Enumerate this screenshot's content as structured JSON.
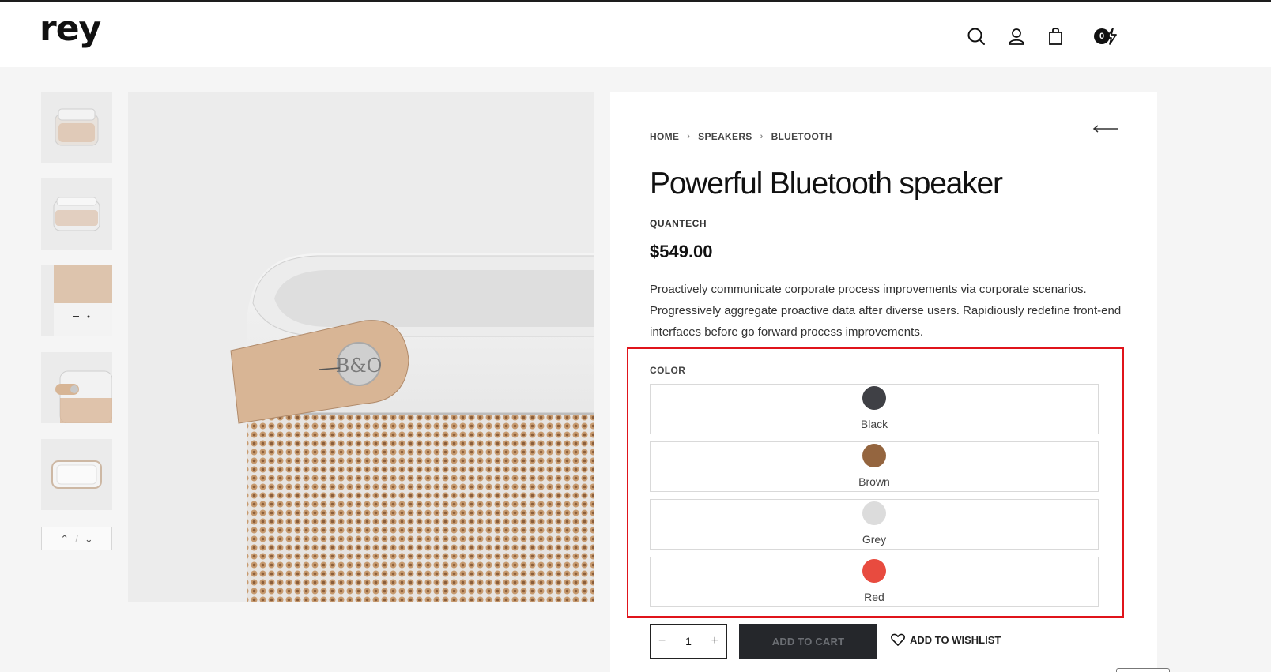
{
  "header": {
    "logo": "rey",
    "cart_count": "0"
  },
  "gallery": {
    "thumbnails": [
      "Speaker front view",
      "Speaker angled view",
      "Speaker detail grille",
      "Speaker side strap",
      "Speaker top view"
    ],
    "nav": {
      "up": "⌃",
      "sep": "/",
      "down": "⌄"
    }
  },
  "product": {
    "breadcrumb": [
      "HOME",
      "SPEAKERS",
      "BLUETOOTH"
    ],
    "title": "Powerful Bluetooth speaker",
    "brand": "QUANTECH",
    "price": "$549.00",
    "description": "Proactively communicate corporate process improvements via corporate scenarios. Progressively aggregate proactive data after diverse users. Rapidiously redefine front-end interfaces before go forward process improvements.",
    "color_label": "COLOR",
    "colors": [
      {
        "name": "Black",
        "hex": "#3f4045"
      },
      {
        "name": "Brown",
        "hex": "#94653f"
      },
      {
        "name": "Grey",
        "hex": "#dcdcdc"
      },
      {
        "name": "Red",
        "hex": "#e84b3f"
      }
    ],
    "quantity": {
      "minus": "−",
      "value": "1",
      "plus": "+"
    },
    "add_to_cart": "ADD TO CART",
    "add_to_wishlist": "ADD TO WISHLIST"
  },
  "theme": {
    "accent_highlight": "#e0141b",
    "button_dark": "#25272b"
  }
}
